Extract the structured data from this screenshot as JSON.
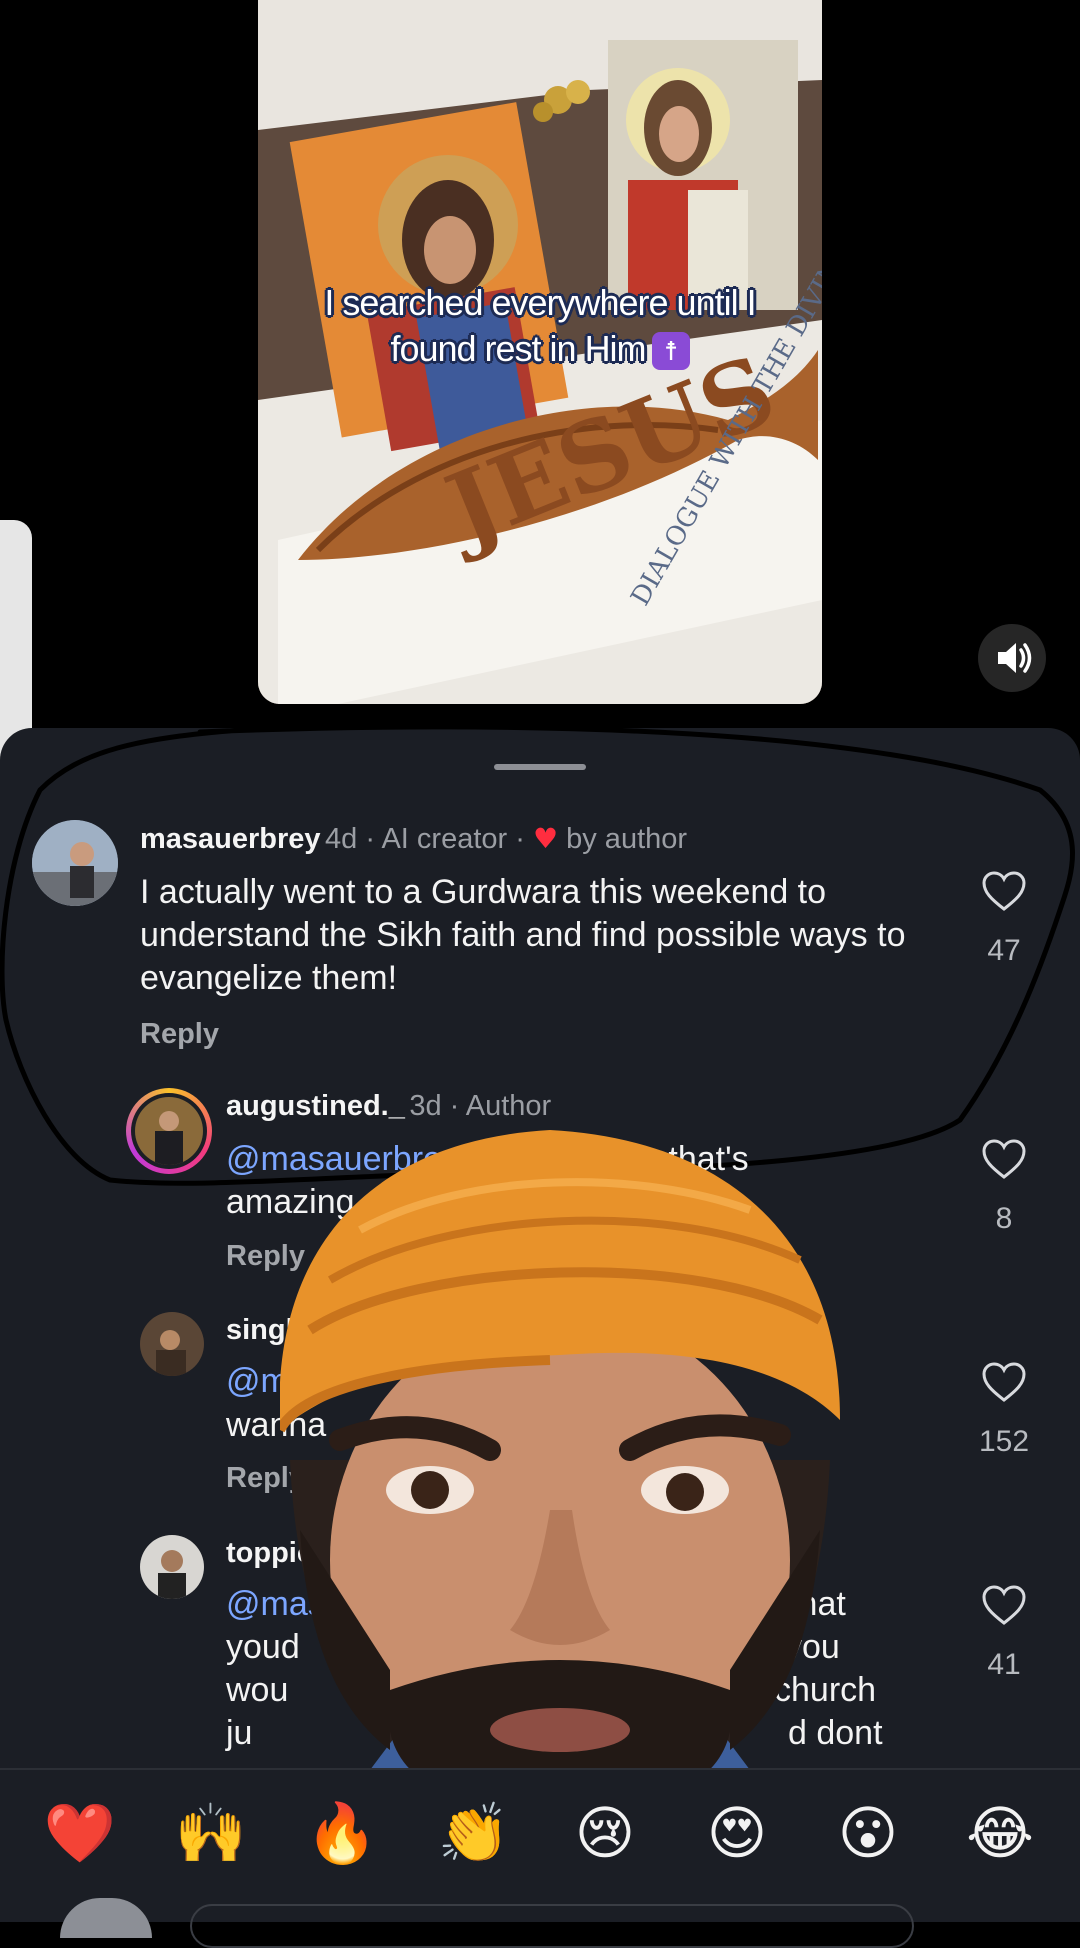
{
  "video": {
    "caption": "I searched everywhere until I found rest in Him",
    "caption_badge": "☨",
    "fish_text": "JESUS",
    "book_text": "DIALOGUE WITH THE DIVINE",
    "mute_icon": "speaker-icon"
  },
  "comments": [
    {
      "username": "masauerbrey",
      "time": "4d",
      "tag": "AI creator",
      "liked_by": "by author",
      "text": "I actually went to a Gurdwara this weekend to understand the Sikh faith and find possible ways to evangelize them!",
      "reply_label": "Reply",
      "likes": "47"
    },
    {
      "username": "augustined._",
      "time": "3d",
      "tag": "Author",
      "mention": "@masauerbrey",
      "text_after_mention": "that's",
      "text_line2": "amazing, k",
      "reply_label": "Reply",
      "likes": "8"
    },
    {
      "username": "singhin",
      "mention": "@mas",
      "text_line2": "wanna",
      "reply_label": "Reply",
      "likes": "152"
    },
    {
      "username": "toppic",
      "mention": "@mas",
      "text_right_1": "what",
      "text_left_2": "youd",
      "text_right_2": "you",
      "text_left_3": "wou",
      "text_right_3": "church",
      "text_left_4": "ju",
      "text_right_4": "d dont",
      "likes": "41"
    }
  ],
  "reaction_bar": {
    "emojis": [
      "❤️",
      "🙌",
      "🔥",
      "👏",
      "😢",
      "😍",
      "😮",
      "😂"
    ]
  },
  "colors": {
    "sheet_bg": "#1b1e25",
    "mention": "#7ca6ff",
    "heart_red": "#ff2d3f",
    "turban": "#e8922a"
  }
}
